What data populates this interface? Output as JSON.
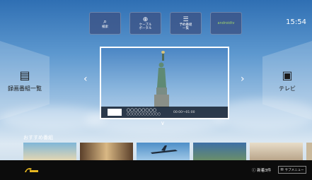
{
  "header": {
    "buttons": [
      {
        "icon": "search-icon",
        "glyph": "⌕",
        "label": "検索"
      },
      {
        "icon": "globe-icon",
        "glyph": "⊕",
        "label": "ケーブル\nポータル"
      },
      {
        "icon": "list-icon",
        "glyph": "☰",
        "label": "予約番組\n一覧"
      },
      {
        "icon": "androidtv-logo",
        "glyph": "",
        "label": "androidtv"
      }
    ],
    "clock": "15:54"
  },
  "left_panel": {
    "icon": "film-icon",
    "glyph": "▤",
    "label": "録画番組一覧"
  },
  "right_panel": {
    "icon": "tv-icon",
    "glyph": "▣",
    "label": "テレビ"
  },
  "nav": {
    "prev": "‹",
    "next": "›",
    "down": "∨"
  },
  "preview": {
    "program_line": "〇〇〇〇〇〇〇〇",
    "program_sub": "〇〇〇〇〇〇〇〇〇〇〇〇",
    "time": "00:00〜01:00"
  },
  "recommended": {
    "title": "おすすめ番組",
    "thumbnails": [
      {
        "name": "beach-thumbnail",
        "colors": [
          "#7fb6d8",
          "#e3d6b2"
        ]
      },
      {
        "name": "temple-thumbnail",
        "colors": [
          "#5a3f2a",
          "#d9b884"
        ]
      },
      {
        "name": "airplane-thumbnail",
        "colors": [
          "#4e8fc8",
          "#9fc7e6"
        ]
      },
      {
        "name": "landscape-thumbnail",
        "colors": [
          "#6a8e6a",
          "#3d6fa5"
        ]
      },
      {
        "name": "cat-thumbnail",
        "colors": [
          "#b9a58a",
          "#e8ddc9"
        ]
      }
    ]
  },
  "footer": {
    "new_count": "新着3件",
    "submenu": "サブメニュー"
  }
}
